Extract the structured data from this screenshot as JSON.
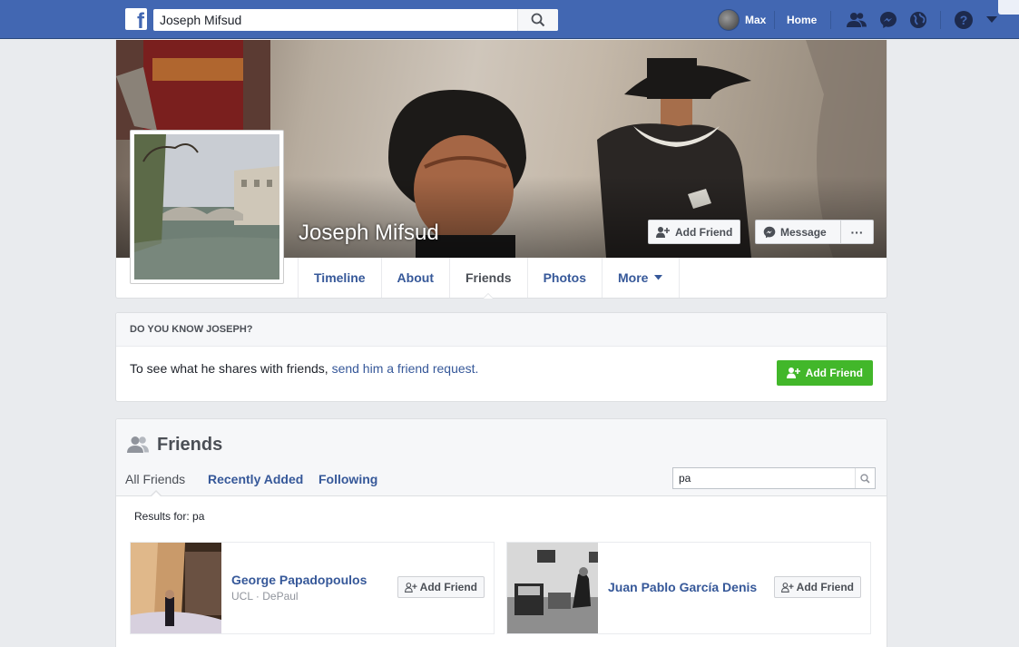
{
  "topbar": {
    "logo_letter": "f",
    "search_value": "Joseph Mifsud",
    "user_name": "Max",
    "home_label": "Home",
    "icons": [
      "friend-requests-icon",
      "messenger-icon",
      "notifications-globe-icon",
      "help-icon",
      "account-menu-caret-icon"
    ],
    "brand_color": "#4267b2"
  },
  "profile": {
    "name": "Joseph Mifsud",
    "add_friend_label": "Add Friend",
    "message_label": "Message",
    "more_dots": "···"
  },
  "tabs": [
    {
      "label": "Timeline",
      "active": false
    },
    {
      "label": "About",
      "active": false
    },
    {
      "label": "Friends",
      "active": true
    },
    {
      "label": "Photos",
      "active": false
    },
    {
      "label": "More",
      "active": false
    }
  ],
  "know": {
    "heading": "DO YOU KNOW JOSEPH?",
    "text": "To see what he shares with friends, ",
    "link": "send him a friend request.",
    "button_label": "Add Friend"
  },
  "friends": {
    "title": "Friends",
    "tabs": [
      "All Friends",
      "Recently Added",
      "Following"
    ],
    "search_value": "pa",
    "results_label": "Results for: pa",
    "items": [
      {
        "name": "George Papadopoulos",
        "subtitle": "UCL · DePaul",
        "button_label": "Add Friend"
      },
      {
        "name": "Juan Pablo García Denis",
        "subtitle": "",
        "button_label": "Add Friend"
      }
    ]
  }
}
